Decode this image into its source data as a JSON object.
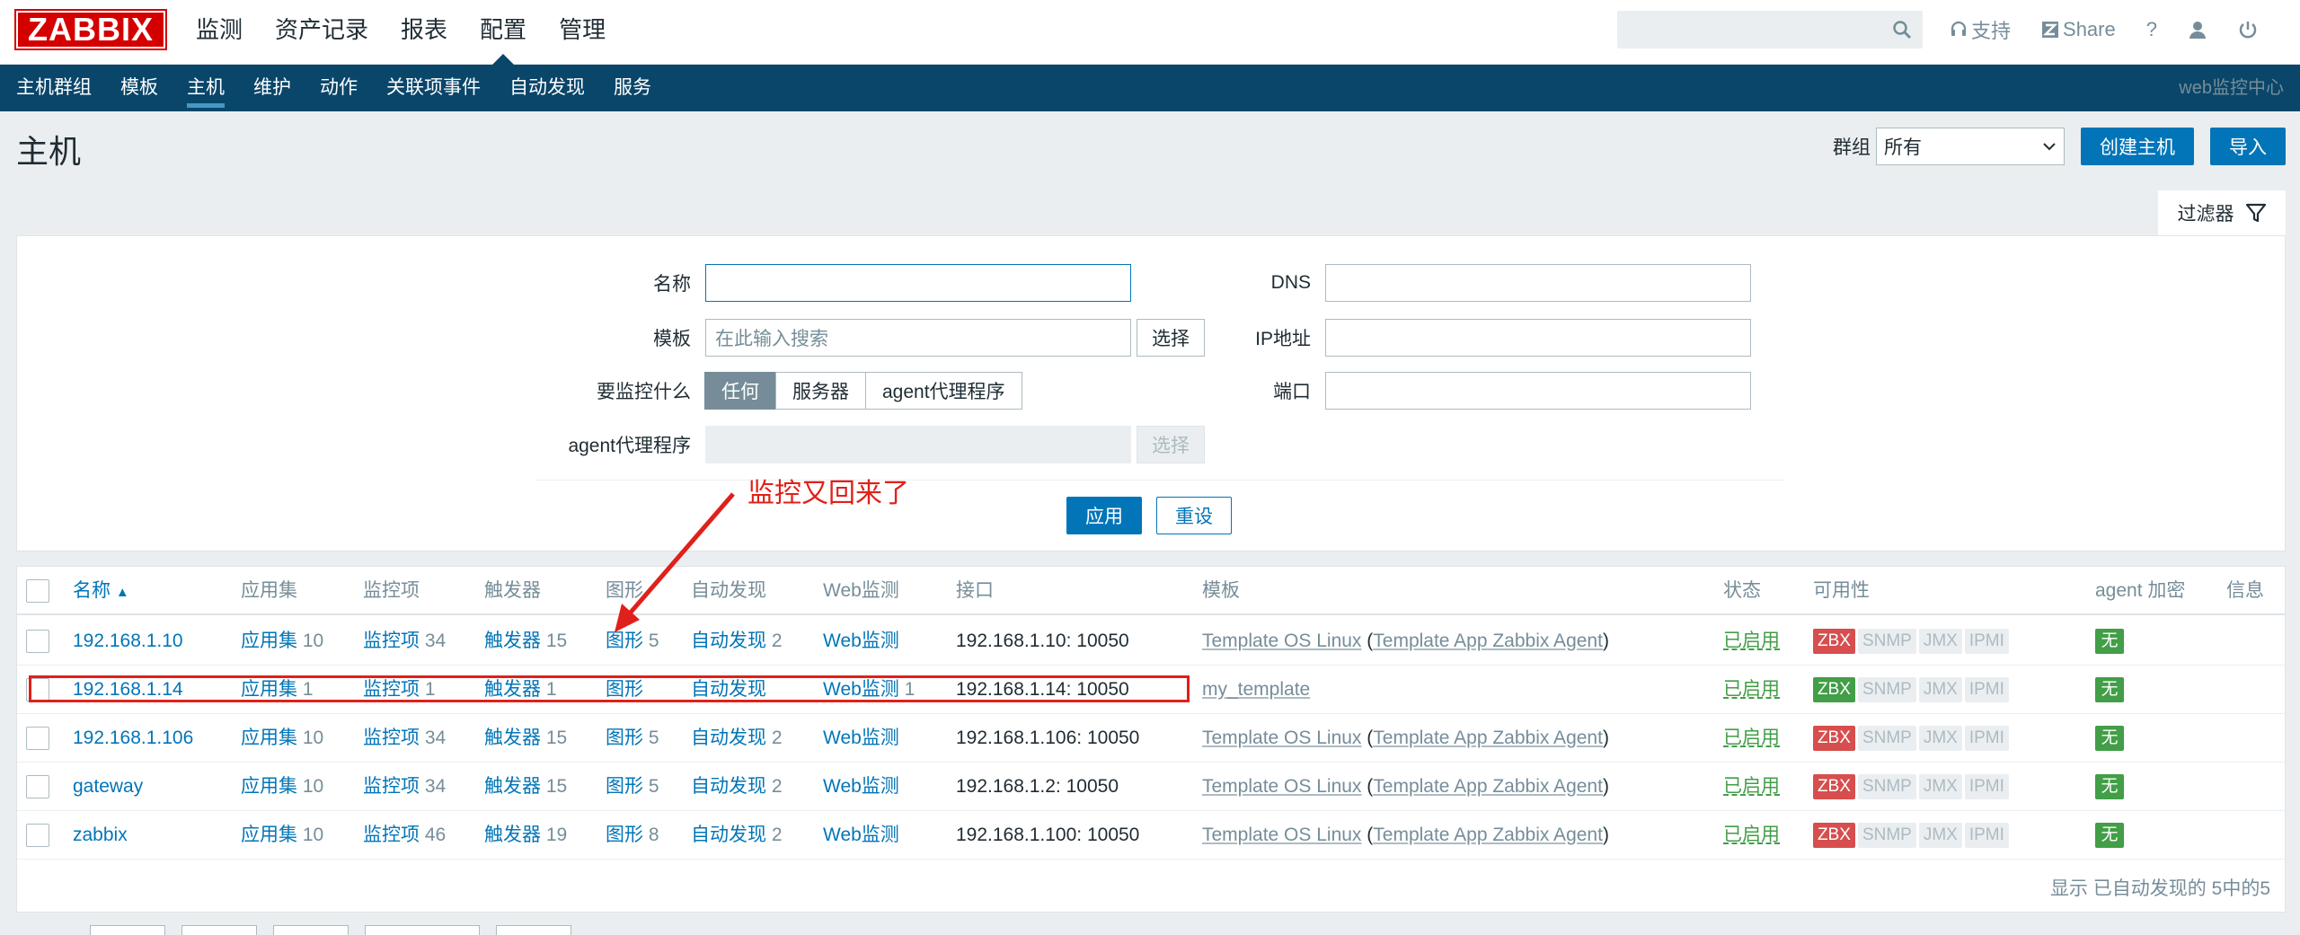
{
  "brand": {
    "logo": "ZABBIX"
  },
  "main_menu": [
    "监测",
    "资产记录",
    "报表",
    "配置",
    "管理"
  ],
  "top_right": {
    "support": "支持",
    "share": "Share",
    "help": "?"
  },
  "sub_menu": [
    "主机群组",
    "模板",
    "主机",
    "维护",
    "动作",
    "关联项事件",
    "自动发现",
    "服务"
  ],
  "server_name": "web监控中心",
  "page": {
    "title": "主机",
    "group_label": "群组",
    "group_value": "所有",
    "create_button": "创建主机",
    "import_button": "导入"
  },
  "filter": {
    "tab_label": "过滤器",
    "name_label": "名称",
    "name_value": "",
    "template_label": "模板",
    "template_placeholder": "在此输入搜索",
    "select_button": "选择",
    "monitor_label": "要监控什么",
    "monitor_options": [
      "任何",
      "服务器",
      "agent代理程序"
    ],
    "proxy_label": "agent代理程序",
    "proxy_select_button": "选择",
    "dns_label": "DNS",
    "ip_label": "IP地址",
    "port_label": "端口",
    "apply_button": "应用",
    "reset_button": "重设"
  },
  "annotation": {
    "text": "监控又回来了"
  },
  "table": {
    "headers": {
      "name": "名称",
      "sort_arrow": "▲",
      "applications": "应用集",
      "items": "监控项",
      "triggers": "触发器",
      "graphs": "图形",
      "discovery": "自动发现",
      "web": "Web监测",
      "interface": "接口",
      "templates": "模板",
      "status": "状态",
      "availability": "可用性",
      "encryption": "agent 加密",
      "info": "信息"
    },
    "rows": [
      {
        "name": "192.168.1.10",
        "app": "应用集",
        "app_n": "10",
        "items": "监控项",
        "items_n": "34",
        "trig": "触发器",
        "trig_n": "15",
        "graph": "图形",
        "graph_n": "5",
        "disc": "自动发现",
        "disc_n": "2",
        "web": "Web监测",
        "web_n": "",
        "iface": "192.168.1.10: 10050",
        "tpl": "Template OS Linux",
        "tpl_sep1": " (",
        "tpl2": "Template App Zabbix Agent",
        "tpl_sep2": ")",
        "status": "已启用",
        "zbx": "ZBX",
        "zbx_color": "#d64e4e",
        "snmp": "SNMP",
        "jmx": "JMX",
        "ipmi": "IPMI",
        "enc": "无"
      },
      {
        "name": "192.168.1.14",
        "app": "应用集",
        "app_n": "1",
        "items": "监控项",
        "items_n": "1",
        "trig": "触发器",
        "trig_n": "1",
        "graph": "图形",
        "graph_n": "",
        "disc": "自动发现",
        "disc_n": "",
        "web": "Web监测",
        "web_n": "1",
        "iface": "192.168.1.14: 10050",
        "tpl": "my_template",
        "tpl_sep1": "",
        "tpl2": "",
        "tpl_sep2": "",
        "status": "已启用",
        "zbx": "ZBX",
        "zbx_color": "#429e47",
        "snmp": "SNMP",
        "jmx": "JMX",
        "ipmi": "IPMI",
        "enc": "无"
      },
      {
        "name": "192.168.1.106",
        "app": "应用集",
        "app_n": "10",
        "items": "监控项",
        "items_n": "34",
        "trig": "触发器",
        "trig_n": "15",
        "graph": "图形",
        "graph_n": "5",
        "disc": "自动发现",
        "disc_n": "2",
        "web": "Web监测",
        "web_n": "",
        "iface": "192.168.1.106: 10050",
        "tpl": "Template OS Linux",
        "tpl_sep1": " (",
        "tpl2": "Template App Zabbix Agent",
        "tpl_sep2": ")",
        "status": "已启用",
        "zbx": "ZBX",
        "zbx_color": "#d64e4e",
        "snmp": "SNMP",
        "jmx": "JMX",
        "ipmi": "IPMI",
        "enc": "无"
      },
      {
        "name": "gateway",
        "app": "应用集",
        "app_n": "10",
        "items": "监控项",
        "items_n": "34",
        "trig": "触发器",
        "trig_n": "15",
        "graph": "图形",
        "graph_n": "5",
        "disc": "自动发现",
        "disc_n": "2",
        "web": "Web监测",
        "web_n": "",
        "iface": "192.168.1.2: 10050",
        "tpl": "Template OS Linux",
        "tpl_sep1": " (",
        "tpl2": "Template App Zabbix Agent",
        "tpl_sep2": ")",
        "status": "已启用",
        "zbx": "ZBX",
        "zbx_color": "#d64e4e",
        "snmp": "SNMP",
        "jmx": "JMX",
        "ipmi": "IPMI",
        "enc": "无"
      },
      {
        "name": "zabbix",
        "app": "应用集",
        "app_n": "10",
        "items": "监控项",
        "items_n": "46",
        "trig": "触发器",
        "trig_n": "19",
        "graph": "图形",
        "graph_n": "8",
        "disc": "自动发现",
        "disc_n": "2",
        "web": "Web监测",
        "web_n": "",
        "iface": "192.168.1.100: 10050",
        "tpl": "Template OS Linux",
        "tpl_sep1": " (",
        "tpl2": "Template App Zabbix Agent",
        "tpl_sep2": ")",
        "status": "已启用",
        "zbx": "ZBX",
        "zbx_color": "#d64e4e",
        "snmp": "SNMP",
        "jmx": "JMX",
        "ipmi": "IPMI",
        "enc": "无"
      }
    ],
    "footer": "显示 已自动发现的 5中的5"
  },
  "colors": {
    "accent": "#0275b8",
    "nav": "#0a466a",
    "annotation": "#e0201a",
    "ok": "#429e47",
    "problem": "#d64e4e"
  }
}
